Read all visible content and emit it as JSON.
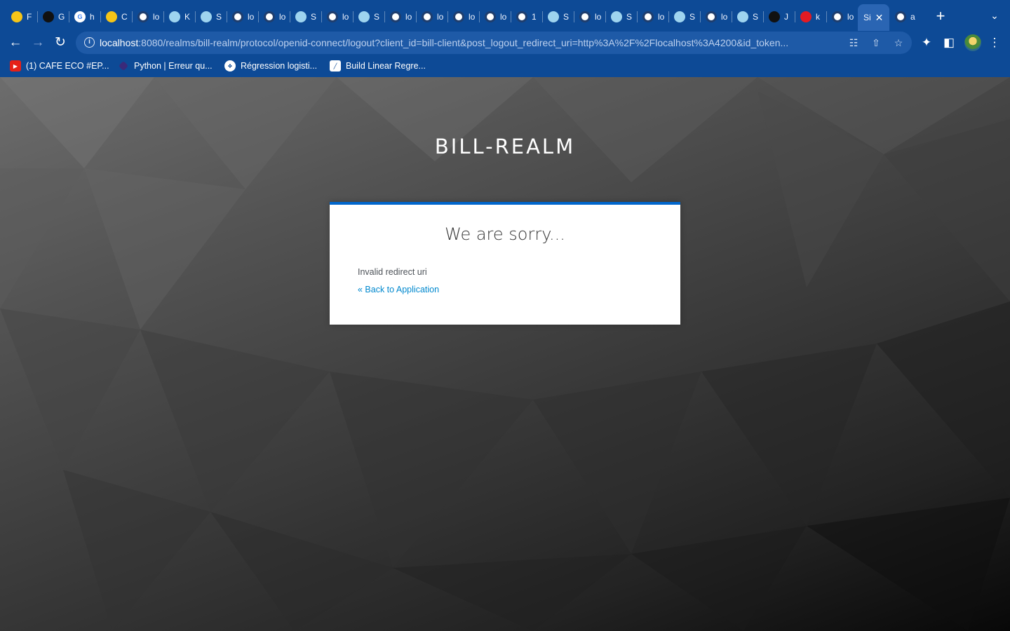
{
  "browser": {
    "tabs": [
      {
        "favicon": "classroom-icon",
        "title": "F"
      },
      {
        "favicon": "github-icon",
        "title": "G"
      },
      {
        "favicon": "google-icon",
        "title": "h"
      },
      {
        "favicon": "classroom-icon",
        "title": "C"
      },
      {
        "favicon": "globe-icon",
        "title": "lo"
      },
      {
        "favicon": "eye-icon",
        "title": "K"
      },
      {
        "favicon": "eye-icon",
        "title": "S"
      },
      {
        "favicon": "globe-icon",
        "title": "lo"
      },
      {
        "favicon": "globe-icon",
        "title": "lo"
      },
      {
        "favicon": "eye-icon",
        "title": "S"
      },
      {
        "favicon": "globe-icon",
        "title": "lo"
      },
      {
        "favicon": "eye-icon",
        "title": "S"
      },
      {
        "favicon": "globe-icon",
        "title": "lo"
      },
      {
        "favicon": "globe-icon",
        "title": "lo"
      },
      {
        "favicon": "globe-icon",
        "title": "lo"
      },
      {
        "favicon": "globe-icon",
        "title": "lo"
      },
      {
        "favicon": "globe-icon",
        "title": "1"
      },
      {
        "favicon": "eye-icon",
        "title": "S"
      },
      {
        "favicon": "globe-icon",
        "title": "lo"
      },
      {
        "favicon": "eye-icon",
        "title": "S"
      },
      {
        "favicon": "globe-icon",
        "title": "lo"
      },
      {
        "favicon": "eye-icon",
        "title": "S"
      },
      {
        "favicon": "globe-icon",
        "title": "lo"
      },
      {
        "favicon": "eye-icon",
        "title": "S"
      },
      {
        "favicon": "dark-icon",
        "title": "J"
      },
      {
        "favicon": "red-icon",
        "title": "k"
      },
      {
        "favicon": "globe-icon",
        "title": "lo"
      },
      {
        "favicon": "none",
        "title": "Si",
        "active": true
      },
      {
        "favicon": "globe-icon",
        "title": "a"
      }
    ],
    "url_host": "localhost",
    "url_rest": ":8080/realms/bill-realm/protocol/openid-connect/logout?client_id=bill-client&post_logout_redirect_uri=http%3A%2F%2Flocalhost%3A4200&id_token...",
    "bookmarks": [
      {
        "icon": "youtube-icon",
        "label": "(1) CAFE ECO #EP..."
      },
      {
        "icon": "python-icon",
        "label": "Python | Erreur qu..."
      },
      {
        "icon": "regression-icon",
        "label": "Régression logisti..."
      },
      {
        "icon": "build-icon",
        "label": "Build Linear Regre..."
      }
    ],
    "accent_color": "#0d4a96"
  },
  "page": {
    "realm_title": "BILL-REALM",
    "card": {
      "title": "We are sorry...",
      "message": "Invalid redirect uri",
      "back_link": "« Back to Application"
    },
    "link_color": "#0088ce",
    "card_border_color": "#0066cc"
  }
}
